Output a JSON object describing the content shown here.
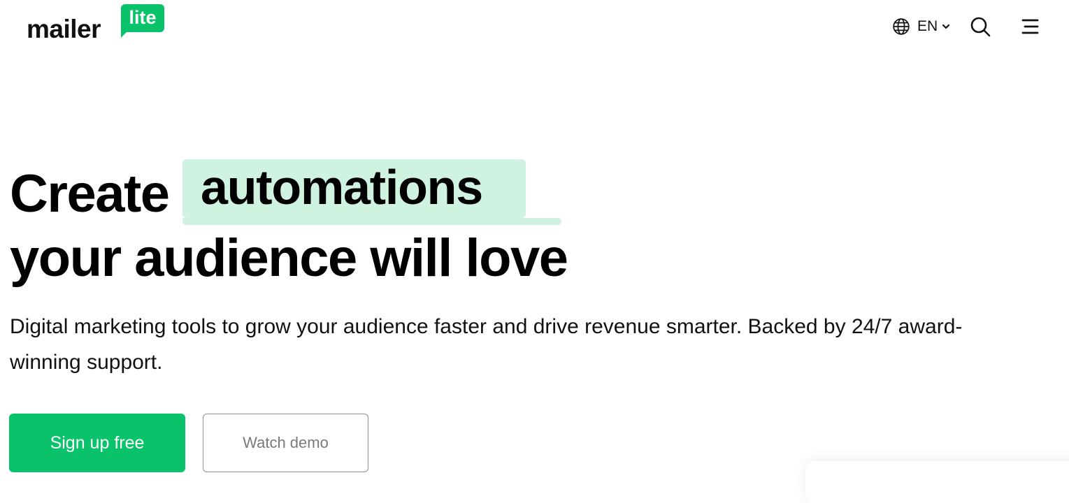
{
  "brand": {
    "logo_word": "mailer",
    "logo_badge": "lite",
    "accent_color": "#09c269",
    "highlight_color": "#d0f2e0"
  },
  "header": {
    "language_icon": "globe-icon",
    "language_label": "EN",
    "language_chevron_icon": "chevron-down-icon",
    "search_icon": "search-icon",
    "menu_icon": "hamburger-menu-icon"
  },
  "hero": {
    "title_prefix": "Create",
    "title_highlight": "automations",
    "title_line2": "your audience will love",
    "subtitle": "Digital marketing tools to grow your audience faster and drive revenue smarter. Backed by 24/7 award-winning support."
  },
  "cta": {
    "primary_label": "Sign up free",
    "secondary_label": "Watch demo"
  }
}
